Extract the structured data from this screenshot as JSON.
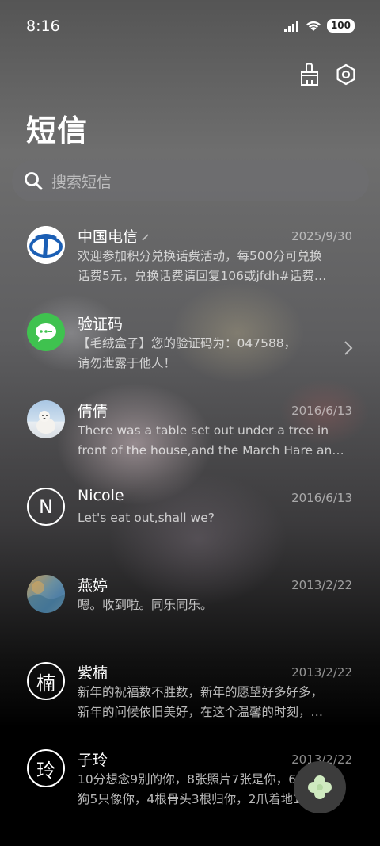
{
  "status": {
    "time": "8:16",
    "battery": "100"
  },
  "header": {
    "title": "短信"
  },
  "search": {
    "placeholder": "搜索短信"
  },
  "messages": [
    {
      "name": "中国电信",
      "date": "2025/9/30",
      "line1": "欢迎参加积分兑换话费活动，每500分可兑换",
      "line2": "话费5元，兑换话费请回复106或jfdh#话费…"
    },
    {
      "name": "验证码",
      "date": "",
      "line1": "【毛绒盒子】您的验证码为：047588，",
      "line2": "请勿泄露于他人！"
    },
    {
      "name": "倩倩",
      "date": "2016/6/13",
      "line1": "There was a table set out under a tree in",
      "line2": "front of the house,and the March Hare an…"
    },
    {
      "name": "Nicole",
      "date": "2016/6/13",
      "line1": "Let's eat out,shall we?",
      "line2": "",
      "avatar_letter": "N"
    },
    {
      "name": "燕婷",
      "date": "2013/2/22",
      "line1": "嗯。收到啦。同乐同乐。",
      "line2": ""
    },
    {
      "name": "紫楠",
      "date": "2013/2/22",
      "line1": "新年的祝福数不胜数，新年的愿望好多好多，",
      "line2": "新年的问候依旧美好，在这个温馨的时刻，…",
      "avatar_letter": "楠"
    },
    {
      "name": "子玲",
      "date": "2013/2/22",
      "line1": "10分想念9别的你，8张照片7张是你，6只小",
      "line2": "狗5只像你，4根骨头3根归你，2爪着地1定…",
      "avatar_letter": "玲"
    }
  ],
  "icons": {
    "top_actions": [
      "broom-icon",
      "settings-icon"
    ],
    "fab": "clover-icon"
  },
  "colors": {
    "green_avatar": "#3fc24f",
    "telecom_blue": "#1b5fb5"
  }
}
